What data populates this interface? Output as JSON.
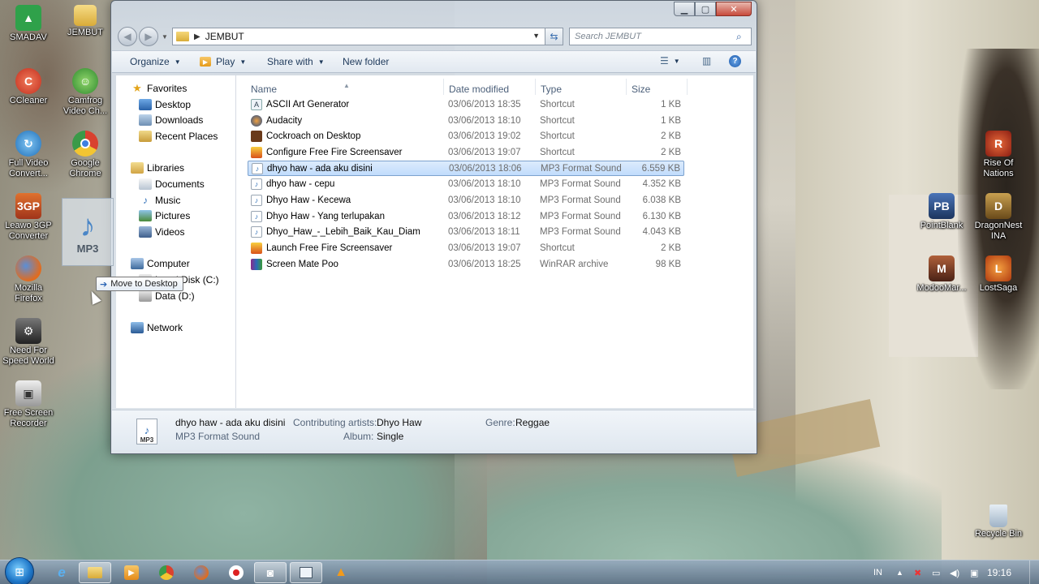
{
  "desktop": {
    "icons_left": [
      {
        "label": "SMADAV",
        "icon": "smadav-icon",
        "color": "#2fa14a"
      },
      {
        "label": "JEMBUT",
        "icon": "folder-icon",
        "color": "#e0b53e"
      },
      {
        "label": "CCleaner",
        "icon": "ccleaner-icon",
        "color": "#d9412f"
      },
      {
        "label": "Camfrog Video Ch...",
        "icon": "camfrog-icon",
        "color": "#3e9a3e"
      },
      {
        "label": "Full Video Convert...",
        "icon": "video-converter-icon",
        "color": "#2f7fc7"
      },
      {
        "label": "Google Chrome",
        "icon": "chrome-icon",
        "color": "#d9412f"
      },
      {
        "label": "Leawo 3GP Converter",
        "icon": "leawo-icon",
        "color": "#c04a20"
      },
      {
        "label": "Mozilla Firefox",
        "icon": "firefox-icon",
        "color": "#e06a1c"
      },
      {
        "label": "Need For Speed World",
        "icon": "nfs-icon",
        "color": "#444444"
      },
      {
        "label": "Free Screen Recorder",
        "icon": "screen-recorder-icon",
        "color": "#666666"
      }
    ],
    "icons_right": [
      {
        "label": "Rise Of Nations",
        "icon": "rise-of-nations-icon",
        "color": "#b53320"
      },
      {
        "label": "PointBlank",
        "icon": "pointblank-icon",
        "color": "#2a4f8a"
      },
      {
        "label": "DragonNest INA",
        "icon": "dragonnest-icon",
        "color": "#8a6a2a"
      },
      {
        "label": "ModooMar...",
        "icon": "modoomarble-icon",
        "color": "#7a3d2a"
      },
      {
        "label": "LostSaga",
        "icon": "lostsaga-icon",
        "color": "#c8501e"
      },
      {
        "label": "Recycle Bin",
        "icon": "recycle-bin-icon",
        "color": "#9fb3c6"
      }
    ]
  },
  "window": {
    "address_path": "JEMBUT",
    "search_placeholder": "Search JEMBUT",
    "toolbar": {
      "organize": "Organize",
      "play": "Play",
      "share_with": "Share with",
      "new_folder": "New folder"
    },
    "nav": {
      "favorites": "Favorites",
      "desktop": "Desktop",
      "downloads": "Downloads",
      "recent_places": "Recent Places",
      "libraries": "Libraries",
      "documents": "Documents",
      "music": "Music",
      "pictures": "Pictures",
      "videos": "Videos",
      "computer": "Computer",
      "local_disk": "Local Disk (C:)",
      "data_d": "Data (D:)",
      "network": "Network"
    },
    "columns": {
      "name": "Name",
      "date": "Date modified",
      "type": "Type",
      "size": "Size"
    },
    "files": [
      {
        "name": "ASCII Art Generator",
        "date": "03/06/2013 18:35",
        "type": "Shortcut",
        "size": "1 KB",
        "icon": "shortcut-icon"
      },
      {
        "name": "Audacity",
        "date": "03/06/2013 18:10",
        "type": "Shortcut",
        "size": "1 KB",
        "icon": "audacity-icon"
      },
      {
        "name": "Cockroach on Desktop",
        "date": "03/06/2013 19:02",
        "type": "Shortcut",
        "size": "2 KB",
        "icon": "cockroach-icon"
      },
      {
        "name": "Configure Free Fire Screensaver",
        "date": "03/06/2013 19:07",
        "type": "Shortcut",
        "size": "2 KB",
        "icon": "fire-icon"
      },
      {
        "name": "dhyo haw - ada aku disini",
        "date": "03/06/2013 18:06",
        "type": "MP3 Format Sound",
        "size": "6.559 KB",
        "icon": "mp3-icon",
        "selected": true
      },
      {
        "name": "dhyo haw - cepu",
        "date": "03/06/2013 18:10",
        "type": "MP3 Format Sound",
        "size": "4.352 KB",
        "icon": "mp3-icon"
      },
      {
        "name": "Dhyo Haw - Kecewa",
        "date": "03/06/2013 18:10",
        "type": "MP3 Format Sound",
        "size": "6.038 KB",
        "icon": "mp3-icon"
      },
      {
        "name": "Dhyo Haw - Yang terlupakan",
        "date": "03/06/2013 18:12",
        "type": "MP3 Format Sound",
        "size": "6.130 KB",
        "icon": "mp3-icon"
      },
      {
        "name": "Dhyo_Haw_-_Lebih_Baik_Kau_Diam",
        "date": "03/06/2013 18:11",
        "type": "MP3 Format Sound",
        "size": "4.043 KB",
        "icon": "mp3-icon"
      },
      {
        "name": "Launch Free Fire Screensaver",
        "date": "03/06/2013 19:07",
        "type": "Shortcut",
        "size": "2 KB",
        "icon": "fire-icon"
      },
      {
        "name": "Screen Mate Poo",
        "date": "03/06/2013 18:25",
        "type": "WinRAR archive",
        "size": "98 KB",
        "icon": "winrar-icon"
      }
    ],
    "details": {
      "title": "dhyo haw - ada aku disini",
      "subtitle": "MP3 Format Sound",
      "artists_label": "Contributing artists:",
      "artists_value": "Dhyo Haw",
      "album_label": "Album:",
      "album_value": "Single",
      "genre_label": "Genre:",
      "genre_value": "Reggae"
    }
  },
  "drag": {
    "ghost_label": "MP3",
    "tooltip": "Move to Desktop"
  },
  "taskbar": {
    "language": "IN",
    "clock": "19:16"
  }
}
